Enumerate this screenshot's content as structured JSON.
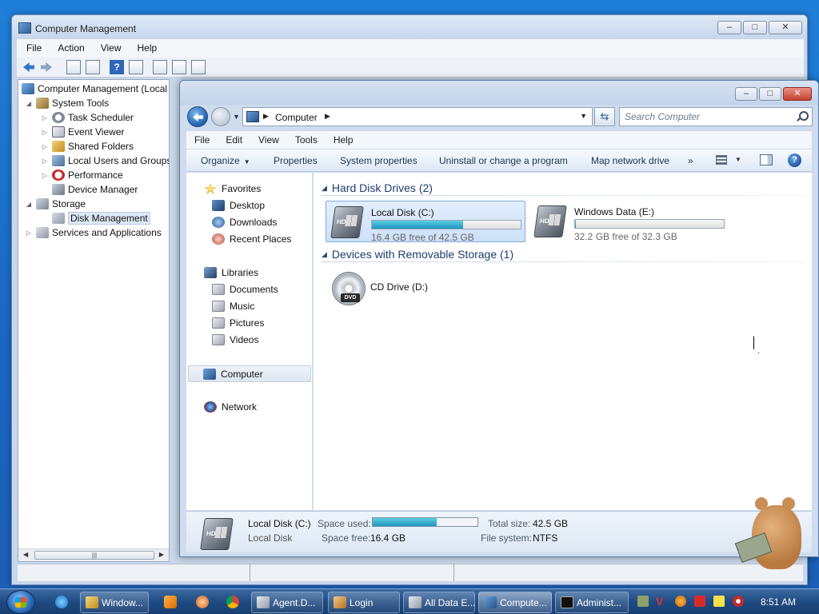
{
  "cm_window": {
    "title": "Computer Management",
    "menu": [
      "File",
      "Action",
      "View",
      "Help"
    ],
    "tree": [
      {
        "label": "Computer Management (Local",
        "level": 0
      },
      {
        "label": "System Tools",
        "level": 1
      },
      {
        "label": "Task Scheduler",
        "level": 2
      },
      {
        "label": "Event Viewer",
        "level": 2
      },
      {
        "label": "Shared Folders",
        "level": 2
      },
      {
        "label": "Local Users and Groups",
        "level": 2
      },
      {
        "label": "Performance",
        "level": 2
      },
      {
        "label": "Device Manager",
        "level": 2
      },
      {
        "label": "Storage",
        "level": 1
      },
      {
        "label": "Disk Management",
        "level": 2,
        "selected": true
      },
      {
        "label": "Services and Applications",
        "level": 1
      }
    ]
  },
  "explorer": {
    "address": {
      "crumb": "Computer"
    },
    "search": {
      "placeholder": "Search Computer"
    },
    "menu": [
      "File",
      "Edit",
      "View",
      "Tools",
      "Help"
    ],
    "commands": {
      "organize": "Organize",
      "properties": "Properties",
      "system_properties": "System properties",
      "uninstall": "Uninstall or change a program",
      "map_drive": "Map network drive",
      "more": "»"
    },
    "nav": {
      "favorites": "Favorites",
      "desktop": "Desktop",
      "downloads": "Downloads",
      "recent": "Recent Places",
      "libraries": "Libraries",
      "documents": "Documents",
      "music": "Music",
      "pictures": "Pictures",
      "videos": "Videos",
      "computer": "Computer",
      "network": "Network"
    },
    "groups": {
      "hdd": "Hard Disk Drives (2)",
      "removable": "Devices with Removable Storage (1)"
    },
    "drives": [
      {
        "name": "Local Disk (C:)",
        "free": "16.4 GB free of 42.5 GB",
        "used_fraction": 0.614,
        "tag": "HD"
      },
      {
        "name": "Windows Data (E:)",
        "free": "32.2 GB free of 32.3 GB",
        "used_fraction": 0.003,
        "tag": "HD"
      }
    ],
    "cd": {
      "name": "CD Drive (D:)",
      "tag": "DVD"
    },
    "details": {
      "name": "Local Disk (C:)",
      "type": "Local Disk",
      "space_used_label": "Space used:",
      "space_free_label": "Space free:",
      "space_free": "16.4 GB",
      "total_label": "Total size:",
      "total": "42.5 GB",
      "fs_label": "File system:",
      "fs": "NTFS",
      "used_fraction": 0.614
    }
  },
  "taskbar": {
    "tasks": [
      {
        "label": "Window..."
      },
      {
        "label": "Agent.D..."
      },
      {
        "label": "Login"
      },
      {
        "label": "All Data E..."
      },
      {
        "label": "Compute..."
      },
      {
        "label": "Administ..."
      }
    ],
    "clock": "8:51 AM"
  }
}
